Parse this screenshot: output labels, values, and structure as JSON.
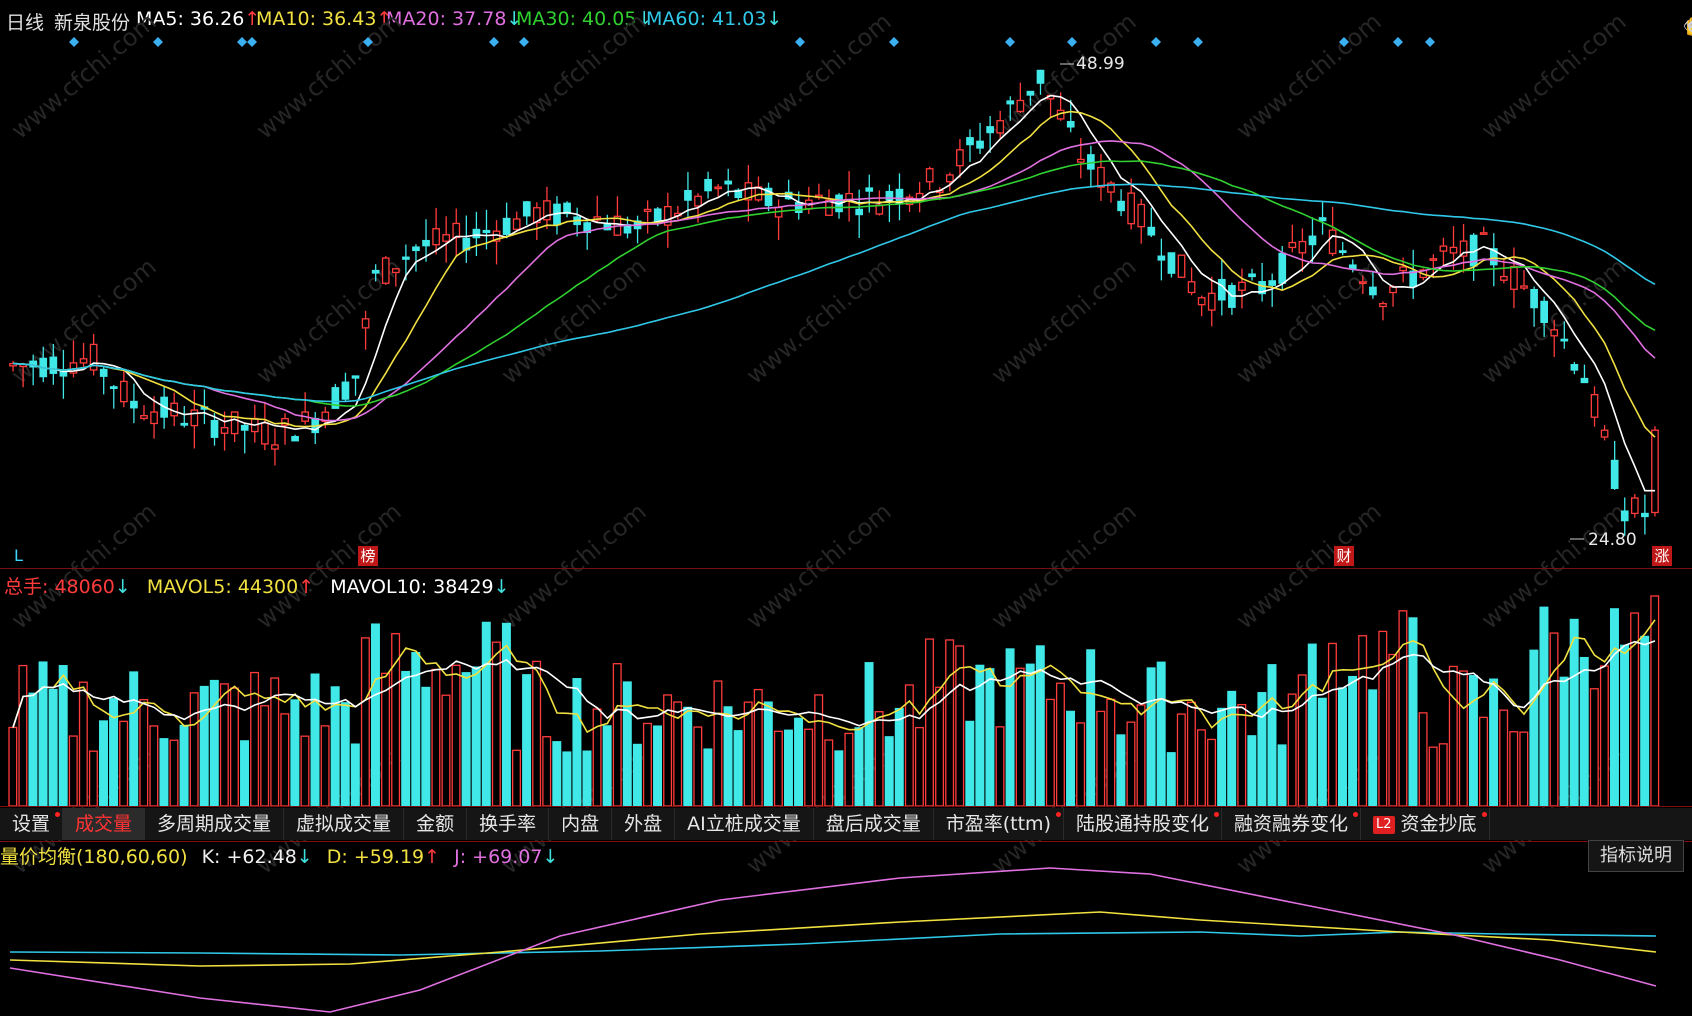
{
  "header": {
    "period": "日线",
    "stock": "新泉股份",
    "ma5": {
      "label": "MA5: 36.26",
      "arrow": "↑",
      "color": "#ffffff",
      "arrow_color": "#ff3b3b"
    },
    "ma10": {
      "label": "MA10: 36.43",
      "arrow": "↑",
      "color": "#f0e040",
      "arrow_color": "#ff3b3b"
    },
    "ma20": {
      "label": "MA20: 37.78",
      "arrow": "↓",
      "color": "#e070e0",
      "arrow_color": "#40e0e0"
    },
    "ma30": {
      "label": "MA30: 40.05",
      "arrow": "↓",
      "color": "#30d030",
      "arrow_color": "#40e0e0"
    },
    "ma60": {
      "label": "MA60: 41.03",
      "arrow": "↓",
      "color": "#30c8e8",
      "arrow_color": "#40e0e0"
    }
  },
  "toolbar_icons": [
    "eye-icon",
    "scissors-icon",
    "play-icon",
    "lock-icon",
    "hand-icon",
    "undo-icon",
    "zoom-in-icon",
    "zoom-out-icon"
  ],
  "markers": {
    "high": "48.99",
    "low": "24.80",
    "left_tag": "L",
    "bang_tag": "榜",
    "cai_tag": "财",
    "zhang_tag": "涨"
  },
  "volume_header": {
    "total": {
      "label": "总手: 48060",
      "arrow": "↓",
      "color": "#ff3b3b",
      "arrow_color": "#40e0e0"
    },
    "mavol5": {
      "label": "MAVOL5: 44300",
      "arrow": "↑",
      "color": "#f0e040",
      "arrow_color": "#ff3b3b"
    },
    "mavol10": {
      "label": "MAVOL10: 38429",
      "arrow": "↓",
      "color": "#ffffff",
      "arrow_color": "#40e0e0"
    }
  },
  "tabs": [
    {
      "label": "设置",
      "dot": true,
      "active": false
    },
    {
      "label": "成交量",
      "dot": false,
      "active": true
    },
    {
      "label": "多周期成交量",
      "dot": false,
      "active": false
    },
    {
      "label": "虚拟成交量",
      "dot": false,
      "active": false
    },
    {
      "label": "金额",
      "dot": false,
      "active": false
    },
    {
      "label": "换手率",
      "dot": false,
      "active": false
    },
    {
      "label": "内盘",
      "dot": false,
      "active": false
    },
    {
      "label": "外盘",
      "dot": false,
      "active": false
    },
    {
      "label": "AI立桩成交量",
      "dot": false,
      "active": false
    },
    {
      "label": "盘后成交量",
      "dot": false,
      "active": false
    },
    {
      "label": "市盈率(ttm)",
      "dot": true,
      "active": false
    },
    {
      "label": "陆股通持股变化",
      "dot": true,
      "active": false
    },
    {
      "label": "融资融券变化",
      "dot": true,
      "active": false
    },
    {
      "label": "资金抄底",
      "dot": true,
      "active": false,
      "badge": "L2"
    }
  ],
  "indicator_header": {
    "name": "量价均衡(180,60,60)",
    "k": {
      "label": "K: +62.48",
      "arrow": "↓",
      "color": "#f0f0f0",
      "arrow_color": "#40e0e0"
    },
    "d": {
      "label": "D: +59.19",
      "arrow": "↑",
      "color": "#f0e040",
      "arrow_color": "#ff3b3b"
    },
    "j": {
      "label": "J: +69.07",
      "arrow": "↓",
      "color": "#e070e0",
      "arrow_color": "#40e0e0"
    },
    "name_color": "#f0e040"
  },
  "indicator_button": "指标说明",
  "watermark": "www.cfchi.com",
  "colors": {
    "up": "#ff3b3b",
    "down": "#40e8e8",
    "ma5": "#ffffff",
    "ma10": "#f0e040",
    "ma20": "#e070e0",
    "ma30": "#30d030",
    "ma60": "#30c8e8"
  },
  "chart_data": {
    "type": "candlestick",
    "price_range": [
      24.8,
      48.99
    ],
    "ma5_end": 36.26,
    "ma10_end": 36.43,
    "ma20_end": 37.78,
    "ma30_end": 40.05,
    "ma60_end": 41.03,
    "last_volume": 48060,
    "mavol5": 44300,
    "mavol10": 38429,
    "indicator": {
      "k": 62.48,
      "d": 59.19,
      "j": 69.07
    }
  }
}
